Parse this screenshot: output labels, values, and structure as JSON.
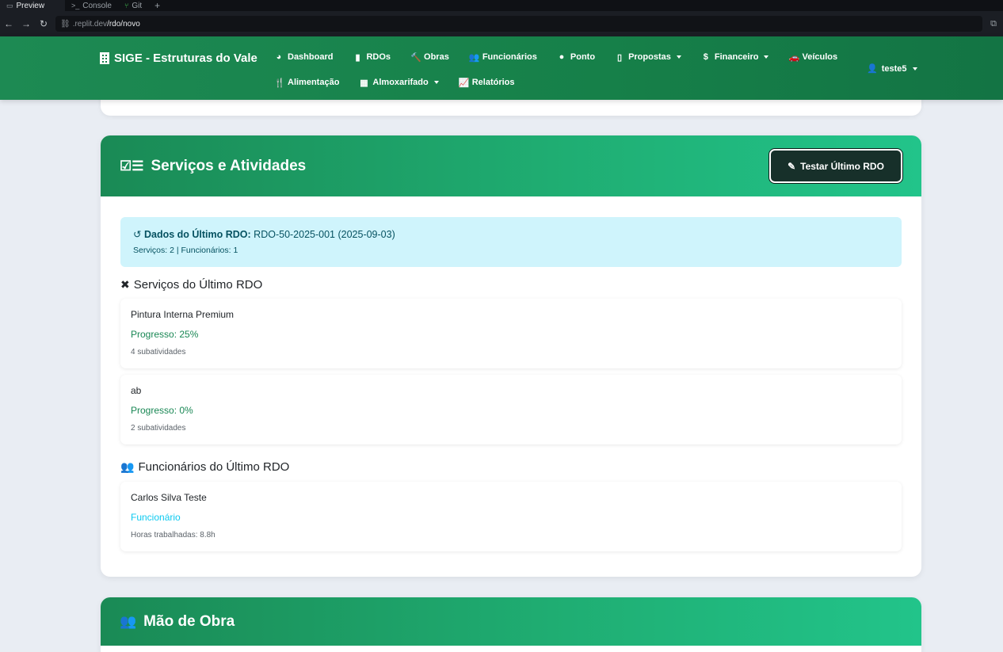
{
  "browser": {
    "tabs": [
      {
        "label": "Preview",
        "icon": "monitor-icon",
        "active": true
      },
      {
        "label": "Console",
        "icon": "terminal-icon",
        "active": false
      },
      {
        "label": "Git",
        "icon": "git-icon",
        "active": false
      }
    ],
    "url_host": ".replit.dev",
    "url_path": "/rdo/novo"
  },
  "navbar": {
    "brand": "SIGE - Estruturas do Vale",
    "row1": [
      {
        "label": "Dashboard",
        "icon": "◕"
      },
      {
        "label": "RDOs",
        "icon": "▮"
      },
      {
        "label": "Obras",
        "icon": "🔨"
      },
      {
        "label": "Funcionários",
        "icon": "👥"
      },
      {
        "label": "Ponto",
        "icon": "●"
      },
      {
        "label": "Propostas",
        "icon": "▯",
        "dropdown": true
      },
      {
        "label": "Financeiro",
        "icon": "$",
        "dropdown": true
      },
      {
        "label": "Veículos",
        "icon": "🚗"
      }
    ],
    "row2": [
      {
        "label": "Alimentação",
        "icon": "🍴"
      },
      {
        "label": "Almoxarifado",
        "icon": "▦",
        "dropdown": true
      },
      {
        "label": "Relatórios",
        "icon": "📈"
      }
    ],
    "user": "teste5"
  },
  "services_card": {
    "title": "Serviços e Atividades",
    "button_label": "Testar Último RDO",
    "alert": {
      "label": "Dados do Último RDO:",
      "value": "RDO-50-2025-001 (2025-09-03)",
      "details": "Serviços: 2 | Funcionários: 1"
    },
    "services_title": "Serviços do Último RDO",
    "services": [
      {
        "name": "Pintura Interna Premium",
        "progress": "Progresso: 25%",
        "subs": "4 subatividades"
      },
      {
        "name": "ab",
        "progress": "Progresso: 0%",
        "subs": "2 subatividades"
      }
    ],
    "employees_title": "Funcionários do Último RDO",
    "employees": [
      {
        "name": "Carlos Silva Teste",
        "role": "Funcionário",
        "hours": "Horas trabalhadas: 8.8h"
      }
    ]
  },
  "mao_card": {
    "title": "Mão de Obra"
  },
  "colors": {
    "brand_green": "#168049",
    "header_gradient_end": "#22c48a",
    "alert_bg": "#cff4fc",
    "progress_green": "#198754",
    "role_cyan": "#0dcaf0"
  }
}
